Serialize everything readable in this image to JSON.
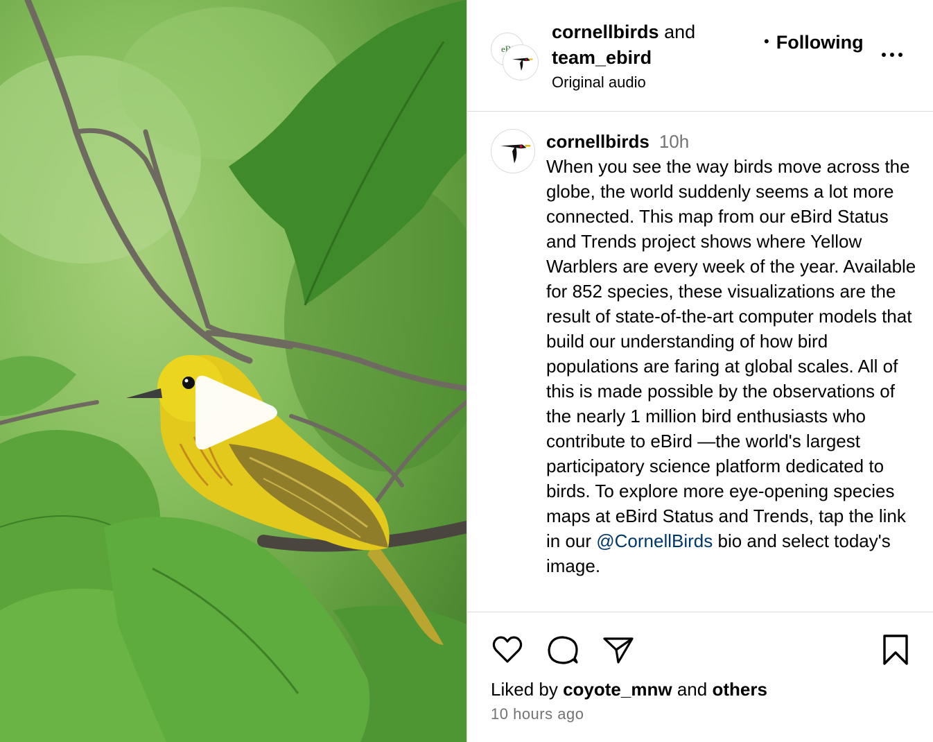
{
  "header": {
    "user1": "cornellbirds",
    "joiner": "and",
    "user2": "team_ebird",
    "audio": "Original audio",
    "follow_label": "Following",
    "avatar_back_text": "eBi"
  },
  "caption": {
    "username": "cornellbirds",
    "time": "10h",
    "text_before_mention": "When you see the way birds move across the globe, the world suddenly seems a lot more connected. This map from our eBird Status and Trends project shows where Yellow Warblers are every week of the year. Available for 852 species, these visualizations are the result of state-of-the-art computer models that build our understanding of how bird populations are faring at global scales. All of this is made possible by the observations of the nearly 1 million bird enthusiasts who contribute to eBird —the world's largest participatory science platform dedicated to birds. To explore more eye-opening species maps at eBird Status and Trends, tap the link in our ",
    "mention": "@CornellBirds",
    "text_after_mention": " bio and select today's image."
  },
  "footer": {
    "liked_prefix": "Liked by",
    "liked_user": "coyote_mnw",
    "liked_joiner": "and",
    "liked_others": "others",
    "time_ago": "10 hours ago"
  },
  "icons": {
    "like": "heart-icon",
    "comment": "comment-icon",
    "share": "send-icon",
    "save": "bookmark-icon",
    "more": "more-options-icon",
    "play": "play-icon"
  },
  "colors": {
    "mention": "#00376b",
    "muted": "#737373",
    "divider": "#dbdbdb",
    "bird_yellow": "#e8d21a"
  }
}
